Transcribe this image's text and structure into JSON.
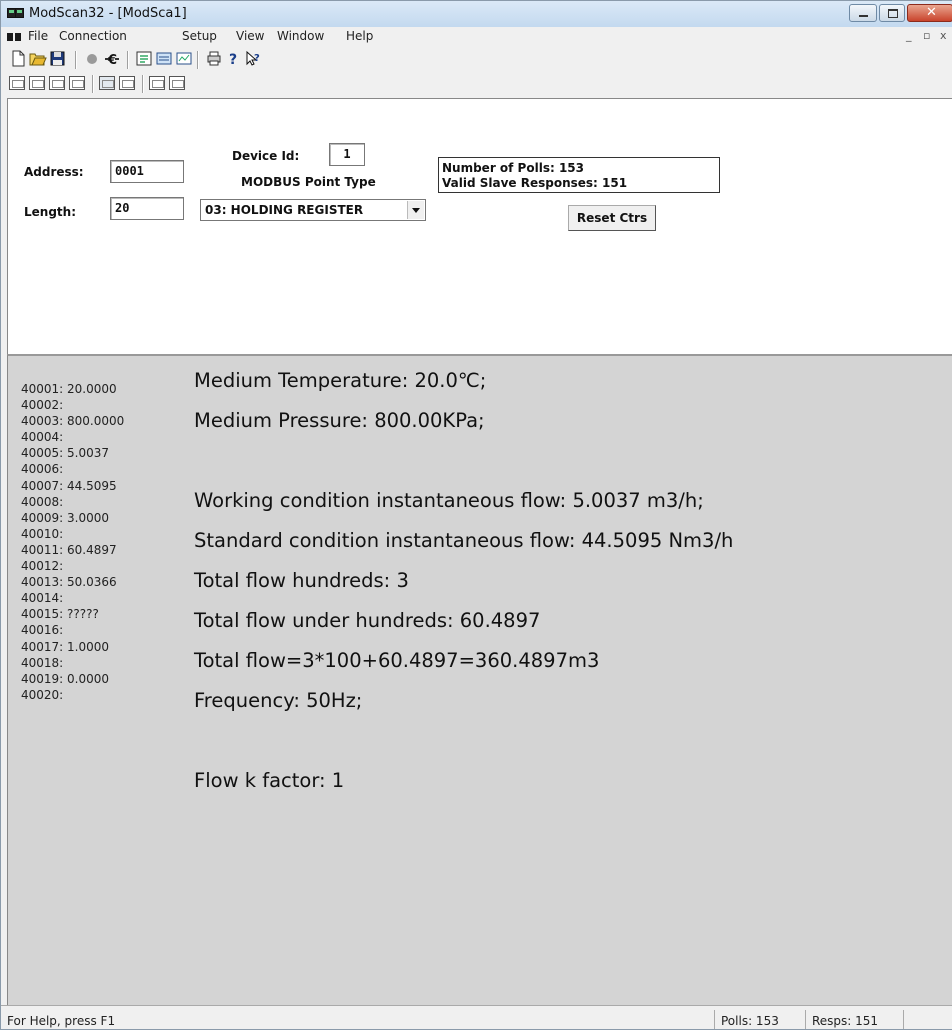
{
  "window": {
    "title": "ModScan32 - [ModSca1]"
  },
  "menu": {
    "items": [
      "File",
      "Connection",
      "Setup",
      "View",
      "Window",
      "Help"
    ],
    "mdi_controls": [
      "_",
      "̸",
      "x"
    ]
  },
  "toolbar": {
    "row1_icons": [
      "new-icon",
      "open-icon",
      "save-icon",
      "connect-icon",
      "disconnect-icon",
      "display-options-icon",
      "data-definition-icon",
      "show-traffic-icon",
      "print-icon",
      "about-icon",
      "context-help-icon"
    ],
    "row2_icons": [
      "coil-status-icon",
      "input-status-icon",
      "input-register-icon",
      "holding-register-icon",
      "display-decimal-icon",
      "display-hex-icon",
      "display-float-icon",
      "display-double-icon"
    ]
  },
  "form": {
    "address_label": "Address:",
    "address_value": "0001",
    "length_label": "Length:",
    "length_value": "20",
    "device_id_label": "Device Id:",
    "device_id_value": "1",
    "point_type_label": "MODBUS Point Type",
    "point_type_value": "03: HOLDING REGISTER",
    "polls_text": "Number of Polls: 153",
    "responses_text": "Valid Slave Responses: 151",
    "reset_label": "Reset Ctrs"
  },
  "registers": [
    "40001: 20.0000",
    "40002:",
    "40003: 800.0000",
    "40004:",
    "40005: 5.0037",
    "40006:",
    "40007: 44.5095",
    "40008:",
    "40009: 3.0000",
    "40010:",
    "40011: 60.4897",
    "40012:",
    "40013: 50.0366",
    "40014:",
    "40015: ?????",
    "40016:",
    "40017: 1.0000",
    "40018:",
    "40019: 0.0000",
    "40020:"
  ],
  "notes": [
    "Medium Temperature: 20.0℃;",
    "Medium Pressure: 800.00KPa;",
    "Working condition instantaneous flow: 5.0037 m3/h;",
    "Standard condition instantaneous flow: 44.5095 Nm3/h",
    "Total flow hundreds: 3",
    "Total flow under hundreds: 60.4897",
    "Total flow=3*100+60.4897=360.4897m3",
    "Frequency: 50Hz;",
    "Flow k factor: 1"
  ],
  "status": {
    "help_text": "For Help, press F1",
    "polls": "Polls: 153",
    "resps": "Resps: 151"
  }
}
